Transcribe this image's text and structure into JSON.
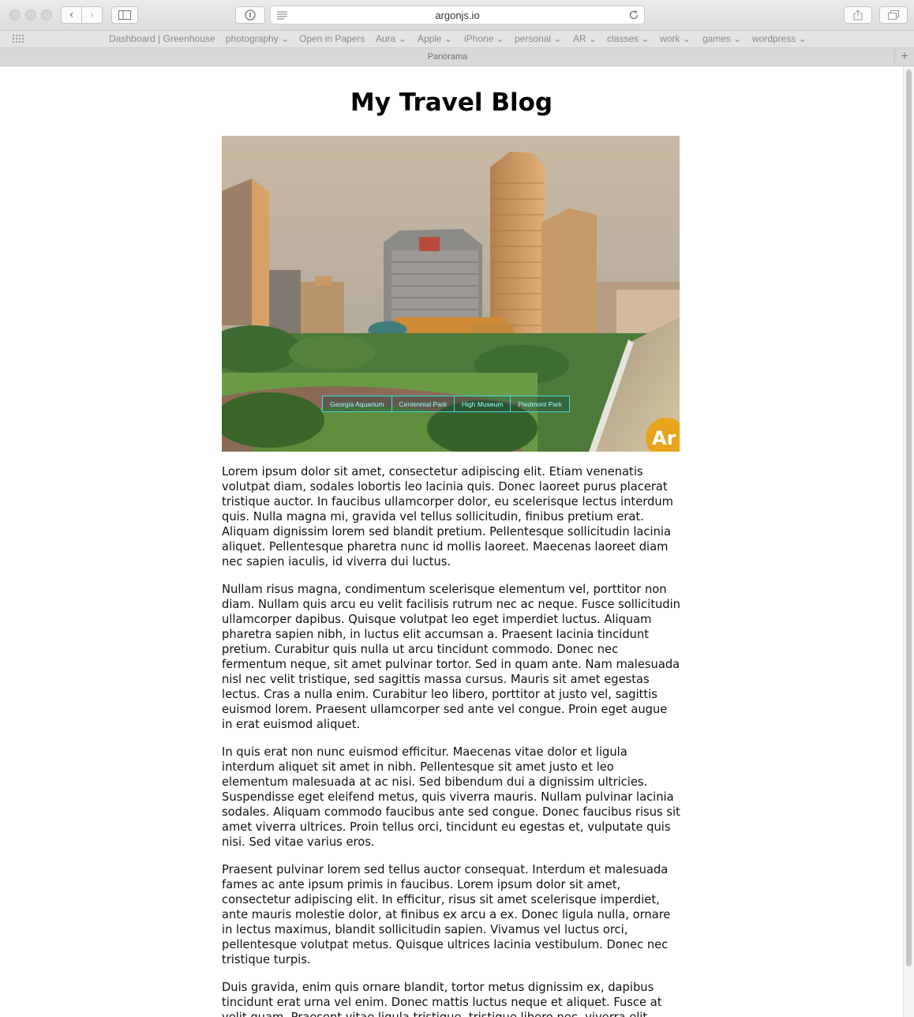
{
  "browser": {
    "url": "argonjs.io",
    "tab_title": "Panorama",
    "bookmarks": [
      {
        "label": "Dashboard | Greenhouse",
        "has_menu": false
      },
      {
        "label": "photography",
        "has_menu": true
      },
      {
        "label": "Open in Papers",
        "has_menu": false
      },
      {
        "label": "Aura",
        "has_menu": true
      },
      {
        "label": "Apple",
        "has_menu": true
      },
      {
        "label": "iPhone",
        "has_menu": true
      },
      {
        "label": "personal",
        "has_menu": true
      },
      {
        "label": "AR",
        "has_menu": true
      },
      {
        "label": "classes",
        "has_menu": true
      },
      {
        "label": "work",
        "has_menu": true
      },
      {
        "label": "games",
        "has_menu": true
      },
      {
        "label": "wordpress",
        "has_menu": true
      }
    ]
  },
  "page": {
    "title": "My Travel Blog",
    "panorama": {
      "points_of_interest": [
        "Georgia Aquarium",
        "Centennial Park",
        "High Museum",
        "Piedmont Park"
      ],
      "badge": "Ar",
      "accent_color": "#3fe0e0",
      "badge_color": "#e8a41c"
    },
    "paragraphs": [
      "Lorem ipsum dolor sit amet, consectetur adipiscing elit. Etiam venenatis volutpat diam, sodales lobortis leo lacinia quis. Donec laoreet purus placerat tristique auctor. In faucibus ullamcorper dolor, eu scelerisque lectus interdum quis. Nulla magna mi, gravida vel tellus sollicitudin, finibus pretium erat. Aliquam dignissim lorem sed blandit pretium. Pellentesque sollicitudin lacinia aliquet. Pellentesque pharetra nunc id mollis laoreet. Maecenas laoreet diam nec sapien iaculis, id viverra dui luctus.",
      "Nullam risus magna, condimentum scelerisque elementum vel, porttitor non diam. Nullam quis arcu eu velit facilisis rutrum nec ac neque. Fusce sollicitudin ullamcorper dapibus. Quisque volutpat leo eget imperdiet luctus. Aliquam pharetra sapien nibh, in luctus elit accumsan a. Praesent lacinia tincidunt pretium. Curabitur quis nulla ut arcu tincidunt commodo. Donec nec fermentum neque, sit amet pulvinar tortor. Sed in quam ante. Nam malesuada nisl nec velit tristique, sed sagittis massa cursus. Mauris sit amet egestas lectus. Cras a nulla enim. Curabitur leo libero, porttitor at justo vel, sagittis euismod lorem. Praesent ullamcorper sed ante vel congue. Proin eget augue in erat euismod aliquet.",
      "In quis erat non nunc euismod efficitur. Maecenas vitae dolor et ligula interdum aliquet sit amet in nibh. Pellentesque sit amet justo et leo elementum malesuada at ac nisi. Sed bibendum dui a dignissim ultricies. Suspendisse eget eleifend metus, quis viverra mauris. Nullam pulvinar lacinia sodales. Aliquam commodo faucibus ante sed congue. Donec faucibus risus sit amet viverra ultrices. Proin tellus orci, tincidunt eu egestas et, vulputate quis nisi. Sed vitae varius eros.",
      "Praesent pulvinar lorem sed tellus auctor consequat. Interdum et malesuada fames ac ante ipsum primis in faucibus. Lorem ipsum dolor sit amet, consectetur adipiscing elit. In efficitur, risus sit amet scelerisque imperdiet, ante mauris molestie dolor, at finibus ex arcu a ex. Donec ligula nulla, ornare in lectus maximus, blandit sollicitudin sapien. Vivamus vel luctus orci, pellentesque volutpat metus. Quisque ultrices lacinia vestibulum. Donec nec tristique turpis.",
      "Duis gravida, enim quis ornare blandit, tortor metus dignissim ex, dapibus tincidunt erat urna vel enim. Donec mattis luctus neque et aliquet. Fusce at velit quam. Praesent vitae ligula tristique, tristique libero nec, viverra elit."
    ]
  }
}
